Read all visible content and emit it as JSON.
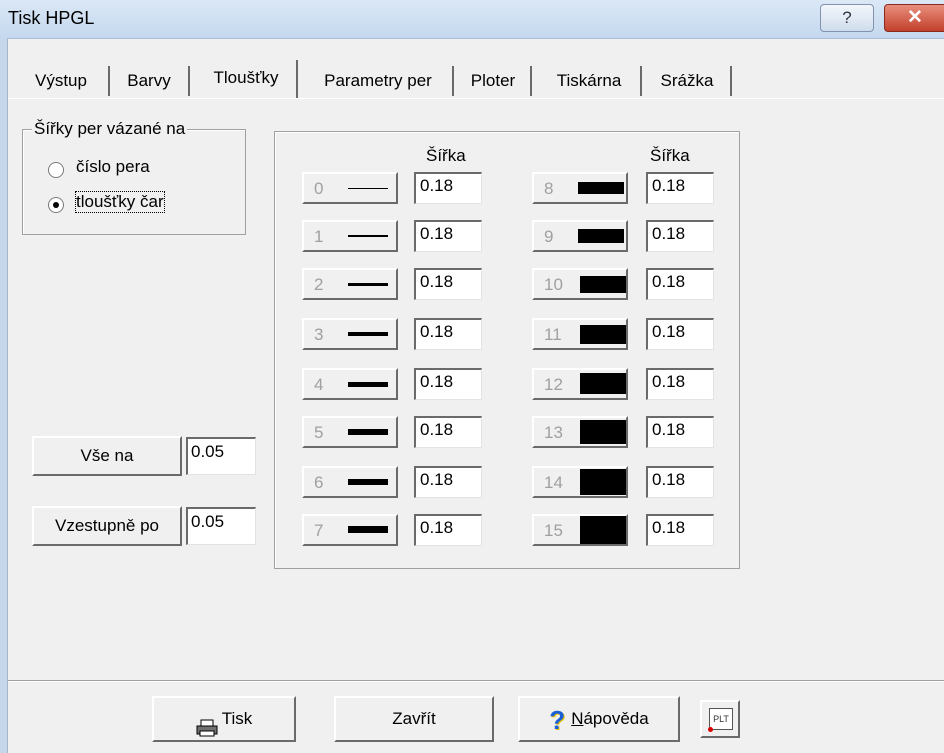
{
  "window": {
    "title": "Tisk HPGL",
    "help_glyph": "?",
    "close_glyph": "✕"
  },
  "tabs": [
    {
      "label": "Výstup"
    },
    {
      "label": "Barvy"
    },
    {
      "label": "Tloušťky",
      "active": true
    },
    {
      "label": "Parametry per"
    },
    {
      "label": "Ploter"
    },
    {
      "label": "Tiskárna"
    },
    {
      "label": "Srážka"
    }
  ],
  "width_binding": {
    "legend": "Šířky per vázané na",
    "options": [
      "číslo pera",
      "tloušťky čar"
    ],
    "selected": "tloušťky čar"
  },
  "pens": {
    "column_header": "Šířka",
    "rows": [
      {
        "number": "0",
        "width": "0.18"
      },
      {
        "number": "1",
        "width": "0.18"
      },
      {
        "number": "2",
        "width": "0.18"
      },
      {
        "number": "3",
        "width": "0.18"
      },
      {
        "number": "4",
        "width": "0.18"
      },
      {
        "number": "5",
        "width": "0.18"
      },
      {
        "number": "6",
        "width": "0.18"
      },
      {
        "number": "7",
        "width": "0.18"
      },
      {
        "number": "8",
        "width": "0.18"
      },
      {
        "number": "9",
        "width": "0.18"
      },
      {
        "number": "10",
        "width": "0.18"
      },
      {
        "number": "11",
        "width": "0.18"
      },
      {
        "number": "12",
        "width": "0.18"
      },
      {
        "number": "13",
        "width": "0.18"
      },
      {
        "number": "14",
        "width": "0.18"
      },
      {
        "number": "15",
        "width": "0.18"
      }
    ]
  },
  "set_all": {
    "label": "Vše na",
    "value": "0.05"
  },
  "ascending": {
    "label": "Vzestupně po",
    "value": "0.05"
  },
  "buttons": {
    "print": "Tisk",
    "close": "Zavřít",
    "help_underlined": "N",
    "help_rest": "ápověda",
    "plt_icon_text": "PLT"
  },
  "colors": {
    "accent": "#1a5fd6",
    "close_button": "#c2402c",
    "disabled_text": "#a0a0a0"
  }
}
